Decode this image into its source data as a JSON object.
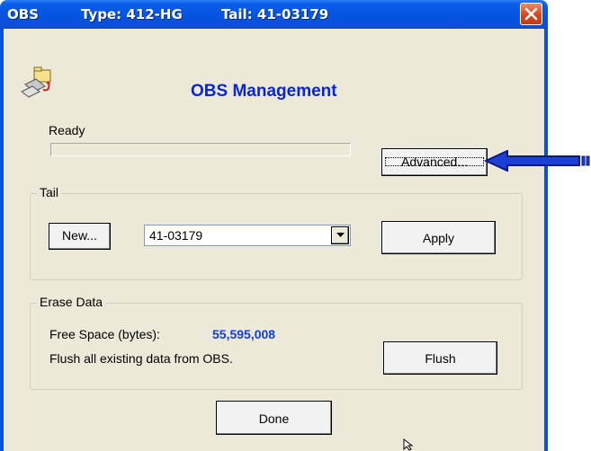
{
  "titlebar": {
    "app": "OBS",
    "type": "Type: 412-HG",
    "tail": "Tail: 41-03179"
  },
  "header": {
    "title": "OBS Management"
  },
  "status": {
    "text": "Ready",
    "progress": 0
  },
  "advanced_button": "Advanced...",
  "tail_group": {
    "label": "Tail",
    "new_button": "New...",
    "selected_tail": "41-03179",
    "apply_button": "Apply"
  },
  "erase_group": {
    "label": "Erase Data",
    "free_space_label": "Free Space (bytes):",
    "free_space_value": "55,595,008",
    "flush_description": "Flush all existing data from OBS.",
    "flush_button": "Flush"
  },
  "done_button": "Done",
  "colors": {
    "titlebar": "#0553e0",
    "dialog_bg": "#ece9d8",
    "heading": "#0a24d8",
    "value": "#1040d8",
    "close": "#d8461c"
  }
}
